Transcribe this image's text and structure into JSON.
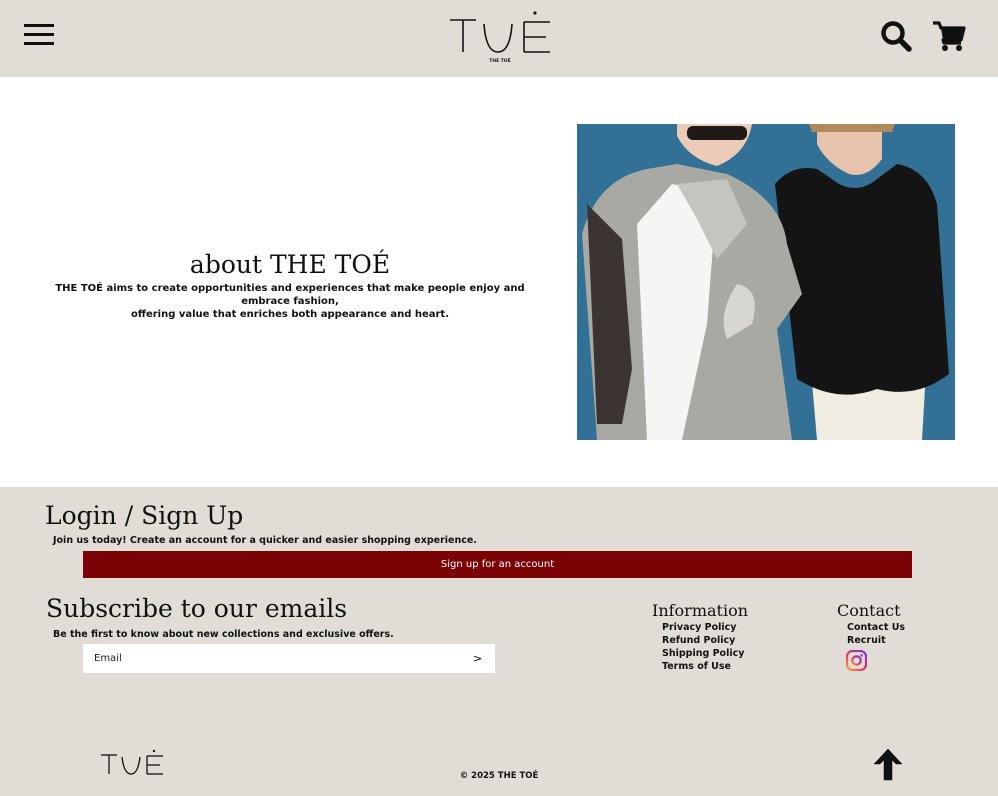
{
  "header": {
    "menu_icon": "hamburger-menu-icon",
    "logo_text": "TOÉ",
    "logo_subtext": "THE TOÉ",
    "search_icon": "search-icon",
    "cart_icon": "shopping-cart-icon"
  },
  "about": {
    "title": "about THE TOÉ",
    "text_line1": "THE TOÉ aims to create opportunities and experiences that make people enjoy and embrace fashion,",
    "text_line2": "offering value that enriches both appearance and heart."
  },
  "footer": {
    "login_title": "Login / Sign Up",
    "login_desc": "Join us today! Create an account for a quicker and easier shopping experience.",
    "signup_button": "Sign up for an account",
    "subscribe_title": "Subscribe to our emails",
    "subscribe_desc": "Be the first to know about new collections and exclusive offers.",
    "email_placeholder": "Email",
    "email_submit": ">",
    "info_title": "Information",
    "info_links": [
      "Privacy Policy",
      "Refund Policy",
      "Shipping Policy",
      "Terms of Use"
    ],
    "contact_title": "Contact",
    "contact_links": [
      "Contact Us",
      "Recruit"
    ],
    "instagram_icon": "instagram-icon",
    "copyright": "© 2025 THE TOÉ",
    "back_to_top_icon": "arrow-up-icon"
  },
  "colors": {
    "header_bg": "#e1ddd6",
    "accent": "#7b0205",
    "text": "#111111"
  }
}
